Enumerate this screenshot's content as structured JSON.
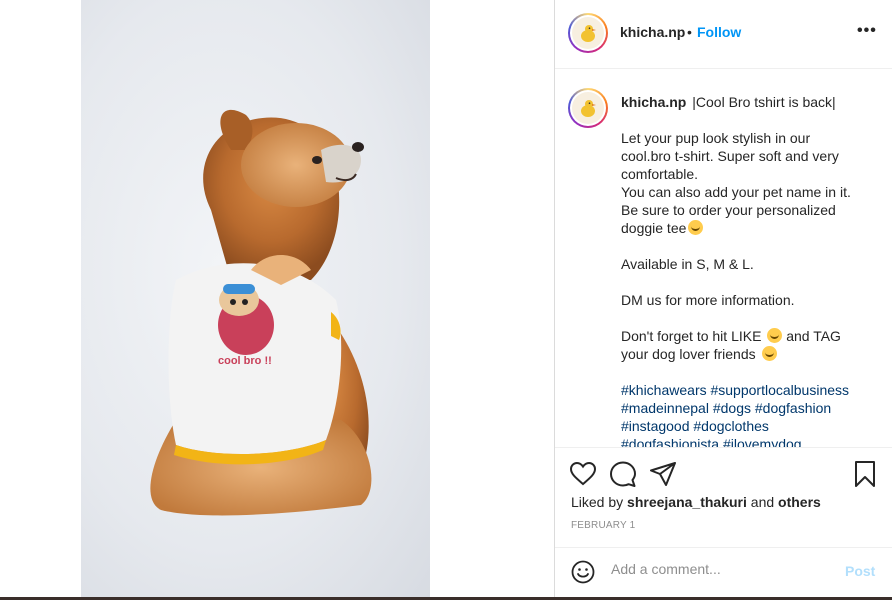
{
  "post": {
    "username": "khicha.np",
    "separator": "•",
    "follow_label": "Follow",
    "more_label": "•••"
  },
  "caption": {
    "username": "khicha.np",
    "lines": [
      "|Cool Bro tshirt is back|",
      "",
      "Let your pup look stylish in our",
      "cool.bro t-shirt. Super soft and very",
      "comfortable.",
      "You can also add your pet name in it.",
      "Be sure to order your personalized",
      "doggie tee",
      "",
      "Available in S, M & L.",
      "",
      "DM us for more information.",
      "",
      "Don't forget to hit LIKE",
      "and TAG",
      "your dog lover friends"
    ],
    "hashtags": [
      "#khichawears #supportlocalbusiness",
      "#madeinnepal #dogs #dogfashion",
      "#instagood #dogclothes",
      "#dogfashionista #ilovemydog"
    ]
  },
  "photo": {
    "shirt_text": "cool bro !!"
  },
  "actions": {
    "liked_by_prefix": "Liked by",
    "liked_by_user": "shreejana_thakuri",
    "liked_by_and": "and",
    "liked_by_others": "others",
    "date": "FEBRUARY 1"
  },
  "comment": {
    "placeholder": "Add a comment...",
    "post_label": "Post"
  },
  "icons": {
    "like": "heart-icon",
    "comment": "comment-icon",
    "share": "share-icon",
    "save": "bookmark-icon",
    "emoji": "smile-icon"
  },
  "colors": {
    "follow": "#0095f6",
    "hashtag": "#00376b",
    "post_disabled": "#b2dffc",
    "secondary_text": "#8e8e8e"
  }
}
